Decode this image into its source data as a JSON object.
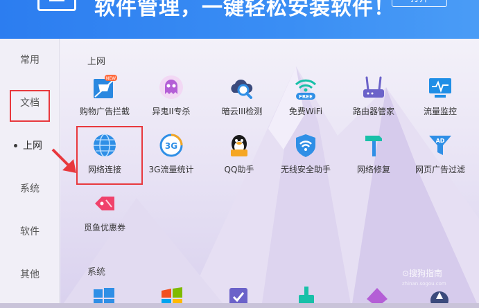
{
  "header": {
    "title": "软件管理，一键轻松安装软件！",
    "open_button": "打开"
  },
  "sidebar": {
    "items": [
      {
        "label": "常用"
      },
      {
        "label": "文档"
      },
      {
        "label": "上网",
        "active": true
      },
      {
        "label": "系统"
      },
      {
        "label": "软件"
      },
      {
        "label": "其他"
      }
    ]
  },
  "sections": {
    "internet": {
      "title": "上网",
      "apps": [
        {
          "label": "购物广告拦截",
          "icon": "shopping-ad-block-icon",
          "badge": "NEW"
        },
        {
          "label": "异鬼II专杀",
          "icon": "ghost-icon"
        },
        {
          "label": "暗云III检测",
          "icon": "cloud-scan-icon"
        },
        {
          "label": "免费WiFi",
          "icon": "free-wifi-icon",
          "badge": "FREE"
        },
        {
          "label": "路由器管家",
          "icon": "router-icon"
        },
        {
          "label": "流量监控",
          "icon": "traffic-monitor-icon"
        },
        {
          "label": "网络连接",
          "icon": "globe-icon"
        },
        {
          "label": "3G流量统计",
          "icon": "3g-icon",
          "badge": "3G"
        },
        {
          "label": "QQ助手",
          "icon": "qq-penguin-icon"
        },
        {
          "label": "无线安全助手",
          "icon": "wifi-shield-icon"
        },
        {
          "label": "网络修复",
          "icon": "hammer-icon"
        },
        {
          "label": "网页广告过滤",
          "icon": "ad-filter-icon",
          "badge": "AD"
        },
        {
          "label": "觅鱼优惠券",
          "icon": "coupon-tag-icon"
        }
      ]
    },
    "system": {
      "title": "系统"
    }
  },
  "watermark": {
    "text": "⊙搜狗指南",
    "sub": "zhinan.sogou.com"
  },
  "colors": {
    "header": "#3a8ef4",
    "highlight": "#e8383d",
    "accent_blue": "#2f8fe6"
  }
}
